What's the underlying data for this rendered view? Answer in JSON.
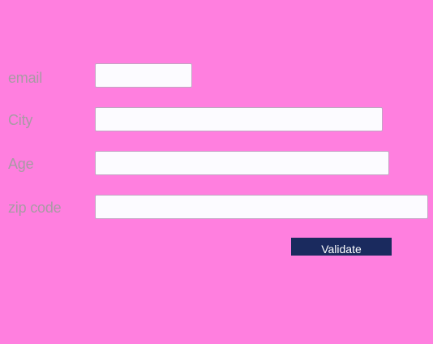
{
  "form": {
    "fields": [
      {
        "label": "email",
        "value": "",
        "placeholder": ""
      },
      {
        "label": "City",
        "value": "",
        "placeholder": ""
      },
      {
        "label": "Age",
        "value": "",
        "placeholder": ""
      },
      {
        "label": "zip code",
        "value": "",
        "placeholder": ""
      }
    ],
    "submit_label": "Validate"
  },
  "colors": {
    "background": "#ff7fdf",
    "label_text": "#a89aa4",
    "input_background": "#fcfbff",
    "button_background": "#1a2a5e",
    "button_text": "#ffffff"
  }
}
